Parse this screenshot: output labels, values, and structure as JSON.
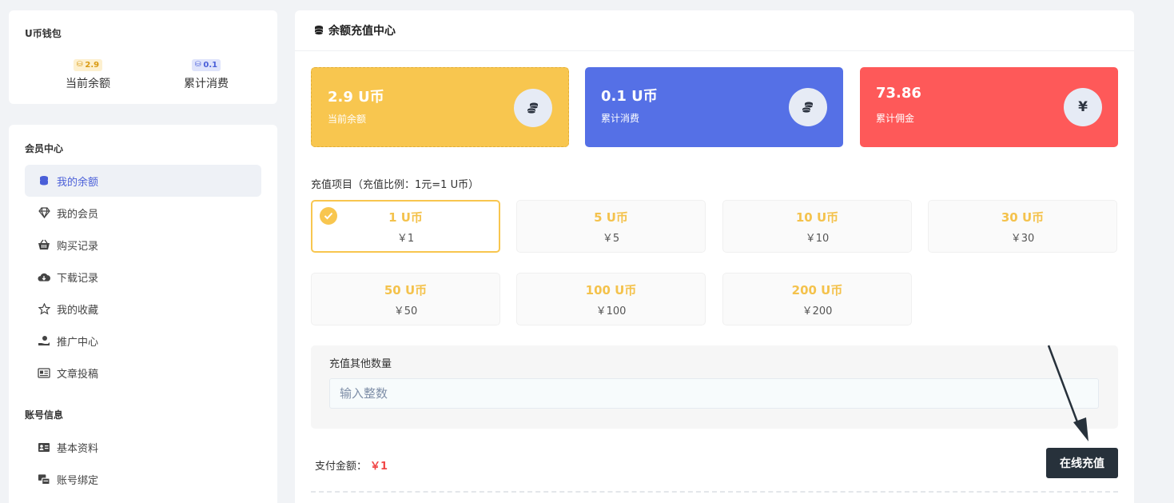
{
  "wallet": {
    "title": "U币钱包",
    "balance_badge": "2.9",
    "balance_label": "当前余额",
    "spent_badge": "0.1",
    "spent_label": "累计消费"
  },
  "member_center": {
    "title": "会员中心",
    "items": [
      {
        "label": "我的余额",
        "icon": "coins-icon",
        "active": true
      },
      {
        "label": "我的会员",
        "icon": "diamond-icon"
      },
      {
        "label": "购买记录",
        "icon": "basket-icon"
      },
      {
        "label": "下载记录",
        "icon": "cloud-download-icon"
      },
      {
        "label": "我的收藏",
        "icon": "star-icon"
      },
      {
        "label": "推广中心",
        "icon": "hand-coin-icon"
      },
      {
        "label": "文章投稿",
        "icon": "newspaper-icon"
      }
    ]
  },
  "account_info": {
    "title": "账号信息",
    "items": [
      {
        "label": "基本资料",
        "icon": "id-card-icon"
      },
      {
        "label": "账号绑定",
        "icon": "account-link-icon"
      }
    ]
  },
  "main": {
    "title": "余额充值中心",
    "cards": [
      {
        "value": "2.9 U币",
        "label": "当前余额",
        "icon": "coins-icon",
        "color": "#f8c64f"
      },
      {
        "value": "0.1 U币",
        "label": "累计消费",
        "icon": "coins-icon",
        "color": "#5570e6"
      },
      {
        "value": "73.86",
        "label": "累计佣金",
        "icon": "yen-icon",
        "icon_text": "¥",
        "color": "#fe5959"
      }
    ],
    "recharge_label": "充值项目（充值比例：1元=1 U币）",
    "options": [
      {
        "amount": "1 U币",
        "price": "￥1",
        "selected": true
      },
      {
        "amount": "5 U币",
        "price": "￥5"
      },
      {
        "amount": "10 U币",
        "price": "￥10"
      },
      {
        "amount": "30 U币",
        "price": "￥30"
      },
      {
        "amount": "50 U币",
        "price": "￥50"
      },
      {
        "amount": "100 U币",
        "price": "￥100"
      },
      {
        "amount": "200 U币",
        "price": "￥200"
      }
    ],
    "custom": {
      "title": "充值其他数量",
      "placeholder": "输入整数",
      "value": ""
    },
    "pay_label": "支付金额：",
    "pay_amount": "￥1",
    "pay_button": "在线充值",
    "accent_color": "#f8c64f",
    "button_color": "#27313b"
  }
}
